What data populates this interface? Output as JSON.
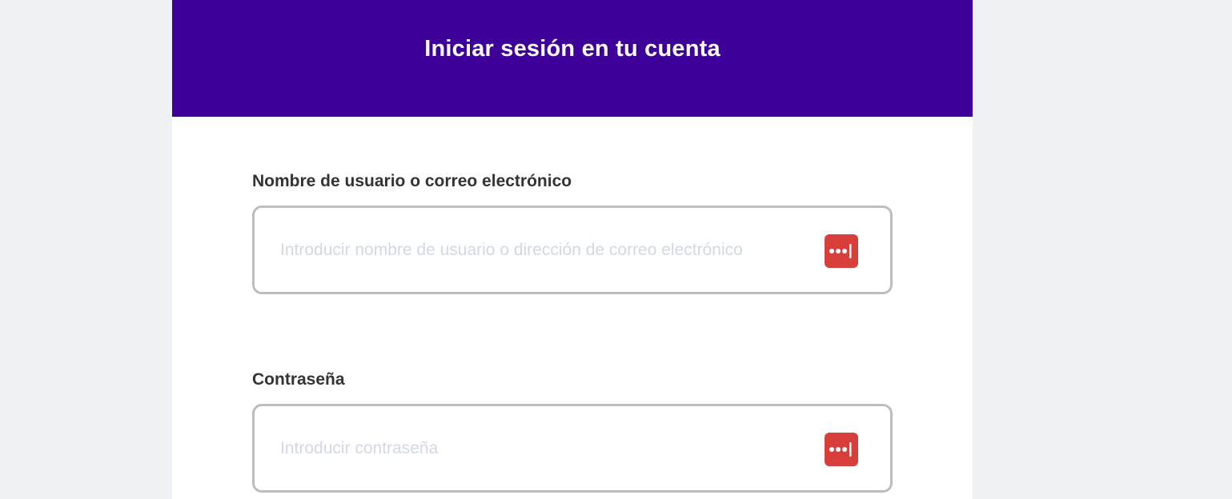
{
  "header": {
    "title": "Iniciar sesión en tu cuenta"
  },
  "form": {
    "username": {
      "label": "Nombre de usuario o correo electrónico",
      "value": "",
      "placeholder": "Introducir nombre de usuario o dirección de correo electrónico"
    },
    "password": {
      "label": "Contraseña",
      "value": "",
      "placeholder": "Introducir contraseña"
    }
  },
  "icons": {
    "password_manager": "password-manager-icon"
  },
  "colors": {
    "header_bg": "#3d0099",
    "page_bg": "#eef2f5",
    "icon_bg": "#d93f3a",
    "input_border": "#bdbdbd",
    "placeholder": "#d2d8e2"
  }
}
